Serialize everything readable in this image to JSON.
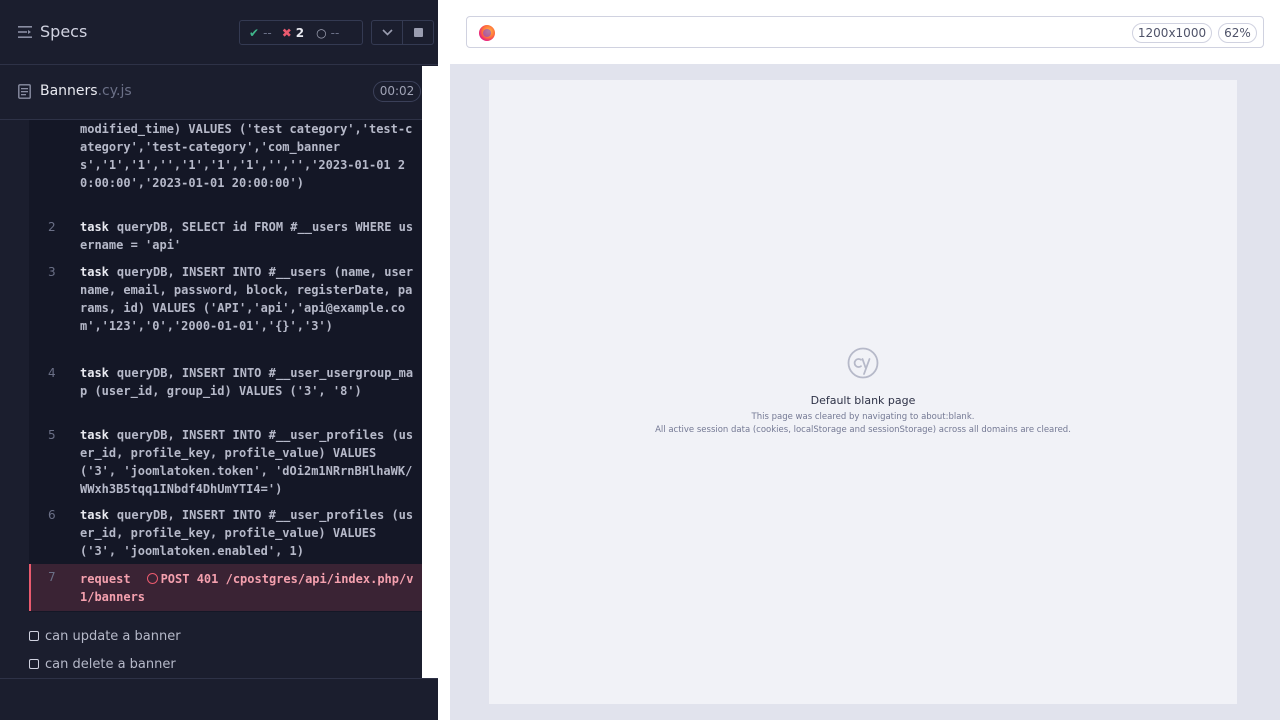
{
  "reporter": {
    "title": "Specs",
    "stats": {
      "passed": "--",
      "failed": "2",
      "pending": "--"
    },
    "spec": {
      "name": "Banners",
      "ext": ".cy.js",
      "duration": "00:02"
    },
    "commands": [
      {
        "num": "",
        "keyword": "",
        "message": "modified_time) VALUES ('test category','test-category','test-category','com_banners','1','1','','1','1','1','','','2023-01-01 20:00:00','2023-01-01 20:00:00')",
        "state": "passed"
      },
      {
        "num": "2",
        "keyword": "task",
        "message": "queryDB, SELECT id FROM #__users WHERE username = 'api'",
        "state": "passed"
      },
      {
        "num": "3",
        "keyword": "task",
        "message": "queryDB, INSERT INTO #__users (name, username, email, password, block, registerDate, params, id) VALUES ('API','api','api@example.com','123','0','2000-01-01','{}','3')",
        "state": "passed"
      },
      {
        "num": "4",
        "keyword": "task",
        "message": "queryDB, INSERT INTO #__user_usergroup_map (user_id, group_id) VALUES ('3', '8')",
        "state": "passed"
      },
      {
        "num": "5",
        "keyword": "task",
        "message": "queryDB, INSERT INTO #__user_profiles (user_id, profile_key, profile_value) VALUES ('3', 'joomlatoken.token', 'dOi2m1NRrnBHlhaWK/WWxh3B5tqq1INbdf4DhUmYTI4=')",
        "state": "passed"
      },
      {
        "num": "6",
        "keyword": "task",
        "message": "queryDB, INSERT INTO #__user_profiles (user_id, profile_key, profile_value) VALUES ('3', 'joomlatoken.enabled', 1)",
        "state": "passed"
      },
      {
        "num": "7",
        "keyword": "request",
        "message": "POST 401 /cpostgres/api/index.php/v1/banners",
        "state": "failed"
      }
    ],
    "tests": [
      {
        "title": "can update a banner"
      },
      {
        "title": "can delete a banner"
      }
    ]
  },
  "aut": {
    "viewport_size": "1200x1000",
    "zoom": "62%",
    "blank_page": {
      "title": "Default blank page",
      "line1": "This page was cleared by navigating to about:blank.",
      "line2": "All active session data (cookies, localStorage and sessionStorage) across all domains are cleared."
    }
  },
  "colors": {
    "reporter_bg": "#1b1e2e",
    "command_bg": "#141726",
    "fail_accent": "#ea5a6e",
    "pass_accent": "#3fb68b"
  }
}
